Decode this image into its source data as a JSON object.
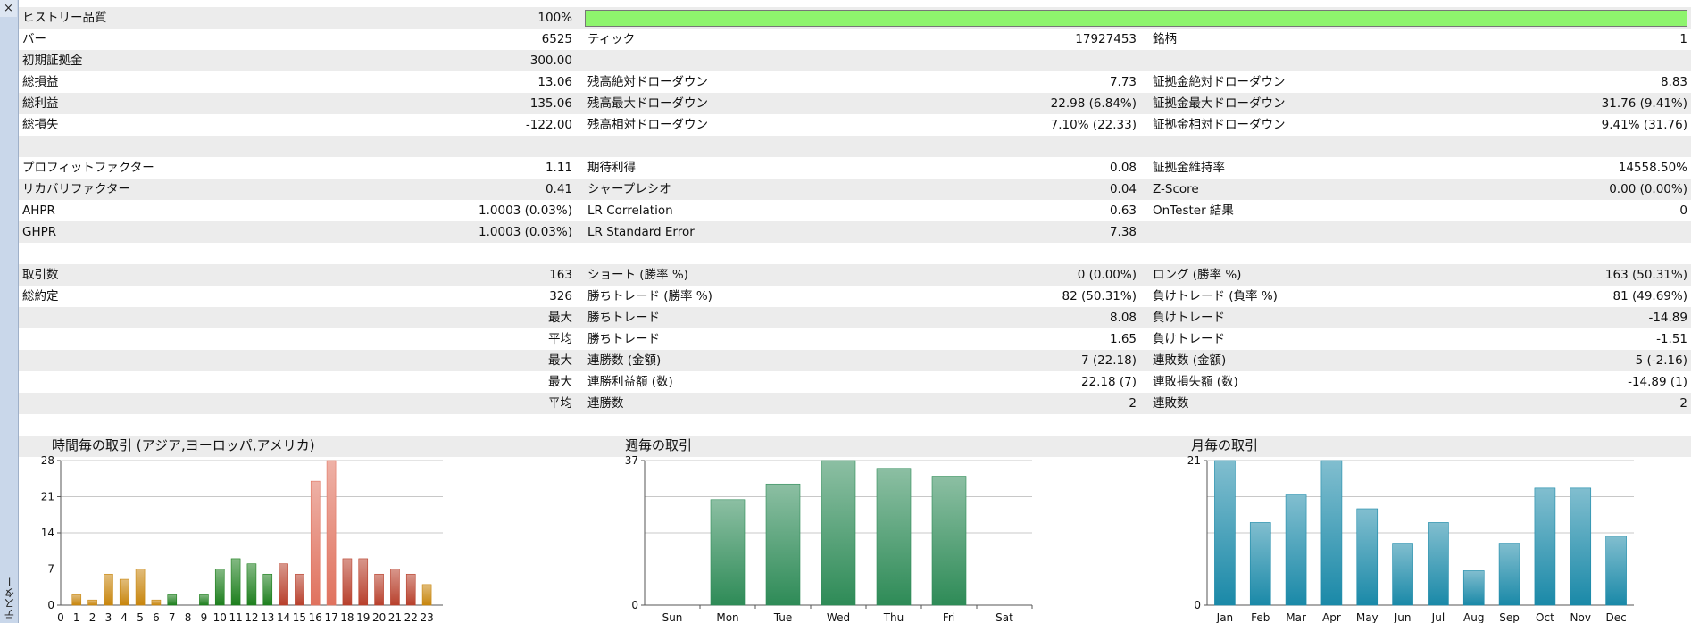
{
  "window": {
    "side_label": "テスター",
    "close_symbol": "×"
  },
  "history_quality": {
    "label": "ヒストリー品質",
    "value": "100%",
    "fraction": 1.0
  },
  "rows": [
    {
      "g": false,
      "l1": "バー",
      "v1": "6525",
      "l2": "ティック",
      "v2": "17927453",
      "l3": "銘柄",
      "v3": "1"
    },
    {
      "g": true,
      "l1": "初期証拠金",
      "v1": "300.00",
      "l2": "",
      "v2": "",
      "l3": "",
      "v3": ""
    },
    {
      "g": false,
      "l1": "総損益",
      "v1": "13.06",
      "l2": "残高絶対ドローダウン",
      "v2": "7.73",
      "l3": "証拠金絶対ドローダウン",
      "v3": "8.83"
    },
    {
      "g": true,
      "l1": "総利益",
      "v1": "135.06",
      "l2": "残高最大ドローダウン",
      "v2": "22.98 (6.84%)",
      "l3": "証拠金最大ドローダウン",
      "v3": "31.76 (9.41%)"
    },
    {
      "g": false,
      "l1": "総損失",
      "v1": "-122.00",
      "l2": "残高相対ドローダウン",
      "v2": "7.10% (22.33)",
      "l3": "証拠金相対ドローダウン",
      "v3": "9.41% (31.76)"
    },
    {
      "g": true,
      "l1": "",
      "v1": "",
      "l2": "",
      "v2": "",
      "l3": "",
      "v3": ""
    },
    {
      "g": false,
      "l1": "プロフィットファクター",
      "v1": "1.11",
      "l2": "期待利得",
      "v2": "0.08",
      "l3": "証拠金維持率",
      "v3": "14558.50%"
    },
    {
      "g": true,
      "l1": "リカバリファクター",
      "v1": "0.41",
      "l2": "シャープレシオ",
      "v2": "0.04",
      "l3": "Z-Score",
      "v3": "0.00 (0.00%)"
    },
    {
      "g": false,
      "l1": "AHPR",
      "v1": "1.0003 (0.03%)",
      "l2": "LR Correlation",
      "v2": "0.63",
      "l3": "OnTester 結果",
      "v3": "0"
    },
    {
      "g": true,
      "l1": "GHPR",
      "v1": "1.0003 (0.03%)",
      "l2": "LR Standard Error",
      "v2": "7.38",
      "l3": "",
      "v3": ""
    },
    {
      "g": false,
      "l1": "",
      "v1": "",
      "l2": "",
      "v2": "",
      "l3": "",
      "v3": ""
    },
    {
      "g": true,
      "l1": "取引数",
      "v1": "163",
      "l2": "ショート (勝率 %)",
      "v2": "0 (0.00%)",
      "l3": "ロング (勝率 %)",
      "v3": "163 (50.31%)"
    },
    {
      "g": false,
      "l1": "総約定",
      "v1": "326",
      "l2": "勝ちトレード (勝率 %)",
      "v2": "82 (50.31%)",
      "l3": "負けトレード (負率 %)",
      "v3": "81 (49.69%)"
    },
    {
      "g": true,
      "l1": "",
      "v1": "最大",
      "l2": "勝ちトレード",
      "v2": "8.08",
      "l3": "負けトレード",
      "v3": "-14.89"
    },
    {
      "g": false,
      "l1": "",
      "v1": "平均",
      "l2": "勝ちトレード",
      "v2": "1.65",
      "l3": "負けトレード",
      "v3": "-1.51"
    },
    {
      "g": true,
      "l1": "",
      "v1": "最大",
      "l2": "連勝数 (金額)",
      "v2": "7 (22.18)",
      "l3": "連敗数 (金額)",
      "v3": "5 (-2.16)"
    },
    {
      "g": false,
      "l1": "",
      "v1": "最大",
      "l2": "連勝利益額 (数)",
      "v2": "22.18 (7)",
      "l3": "連敗損失額 (数)",
      "v3": "-14.89 (1)"
    },
    {
      "g": true,
      "l1": "",
      "v1": "平均",
      "l2": "連勝数",
      "v2": "2",
      "l3": "連敗数",
      "v3": "2"
    },
    {
      "g": false,
      "l1": "",
      "v1": "",
      "l2": "",
      "v2": "",
      "l3": "",
      "v3": ""
    },
    {
      "g": true,
      "l1": "",
      "v1": "",
      "l2": "",
      "v2": "",
      "l3": "",
      "v3": ""
    }
  ],
  "chart_data": [
    {
      "type": "bar",
      "title": "時間毎の取引 (アジア,ヨーロッパ,アメリカ)",
      "categories": [
        "0",
        "1",
        "2",
        "3",
        "4",
        "5",
        "6",
        "7",
        "8",
        "9",
        "10",
        "11",
        "12",
        "13",
        "14",
        "15",
        "16",
        "17",
        "18",
        "19",
        "20",
        "21",
        "22",
        "23"
      ],
      "values": [
        0,
        2,
        1,
        6,
        5,
        7,
        1,
        2,
        0,
        2,
        7,
        9,
        8,
        6,
        8,
        6,
        24,
        28,
        9,
        9,
        6,
        7,
        6,
        4
      ],
      "colors": [
        "#c8860d",
        "#c8860d",
        "#c8860d",
        "#c8860d",
        "#c8860d",
        "#c8860d",
        "#c8860d",
        "#1d7f1d",
        "#1d7f1d",
        "#1d7f1d",
        "#1d7f1d",
        "#1d7f1d",
        "#1d7f1d",
        "#1d7f1d",
        "#b8402c",
        "#b8402c",
        "#e0725e",
        "#e0725e",
        "#b8402c",
        "#b8402c",
        "#b8402c",
        "#b8402c",
        "#b8402c",
        "#c8860d"
      ],
      "yticks": [
        0,
        7,
        14,
        21,
        28
      ],
      "ylim": [
        0,
        28
      ],
      "grid": true
    },
    {
      "type": "bar",
      "title": "週毎の取引",
      "categories": [
        "Sun",
        "Mon",
        "Tue",
        "Wed",
        "Thu",
        "Fri",
        "Sat"
      ],
      "values": [
        0,
        27,
        31,
        37,
        35,
        33,
        0
      ],
      "colors": [
        "#2e8b57",
        "#2e8b57",
        "#2e8b57",
        "#2e8b57",
        "#2e8b57",
        "#2e8b57",
        "#2e8b57"
      ],
      "yticks": [
        0,
        37
      ],
      "ylim": [
        0,
        37
      ],
      "grid": true
    },
    {
      "type": "bar",
      "title": "月毎の取引",
      "categories": [
        "Jan",
        "Feb",
        "Mar",
        "Apr",
        "May",
        "Jun",
        "Jul",
        "Aug",
        "Sep",
        "Oct",
        "Nov",
        "Dec"
      ],
      "values": [
        21,
        12,
        16,
        21,
        14,
        9,
        12,
        5,
        9,
        17,
        17,
        10
      ],
      "colors": [
        "#1a89a8",
        "#1a89a8",
        "#1a89a8",
        "#1a89a8",
        "#1a89a8",
        "#1a89a8",
        "#1a89a8",
        "#1a89a8",
        "#1a89a8",
        "#1a89a8",
        "#1a89a8",
        "#1a89a8"
      ],
      "yticks": [
        0,
        21
      ],
      "ylim": [
        0,
        21
      ],
      "grid": true
    }
  ]
}
